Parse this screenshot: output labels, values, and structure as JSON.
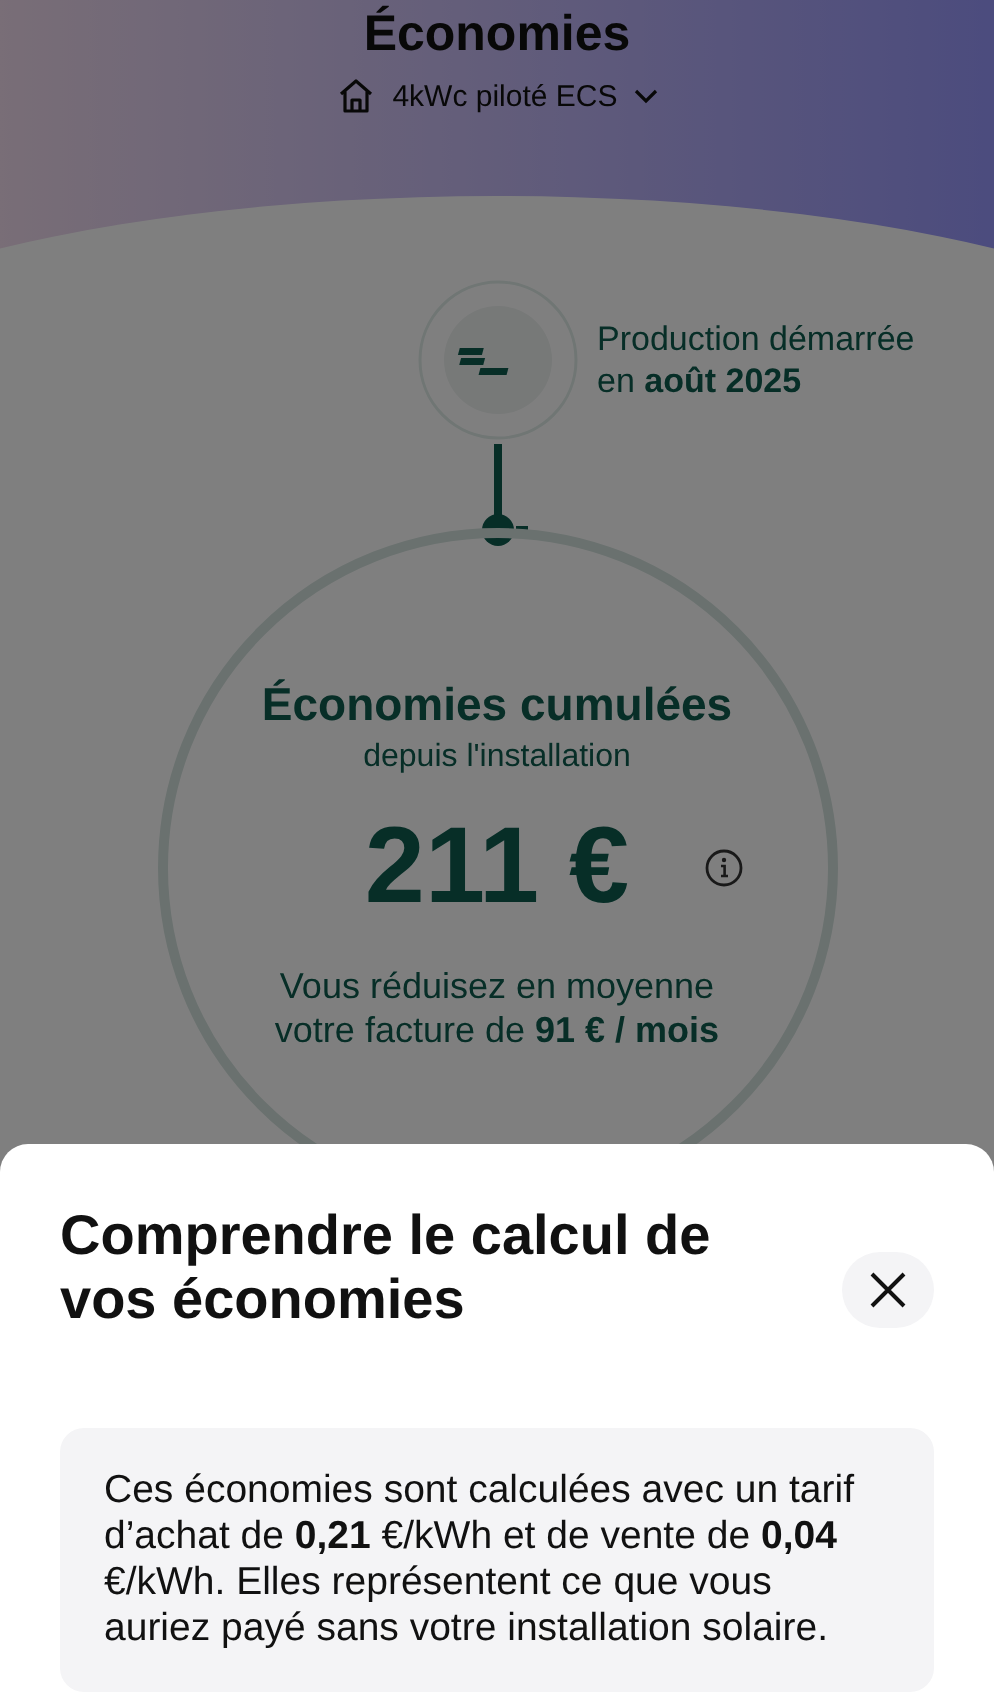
{
  "header": {
    "title": "Économies",
    "site": "4kWc piloté ECS"
  },
  "production": {
    "text": "Production démarrée en **août 2025**"
  },
  "savings": {
    "title": "Économies cumulées",
    "subtitle": "depuis l'installation",
    "amount": "211 €",
    "monthly": "Vous réduisez en moyenne votre facture de **91 € / mois**"
  },
  "sheet": {
    "title": "Comprendre le calcul de vos économies",
    "body": "Ces économies sont calculées avec un tarif d’achat de **0,21** €/kWh et de vente de **0,04** €/kWh. Elles représentent ce que vous auriez payé sans votre installation solaire."
  }
}
